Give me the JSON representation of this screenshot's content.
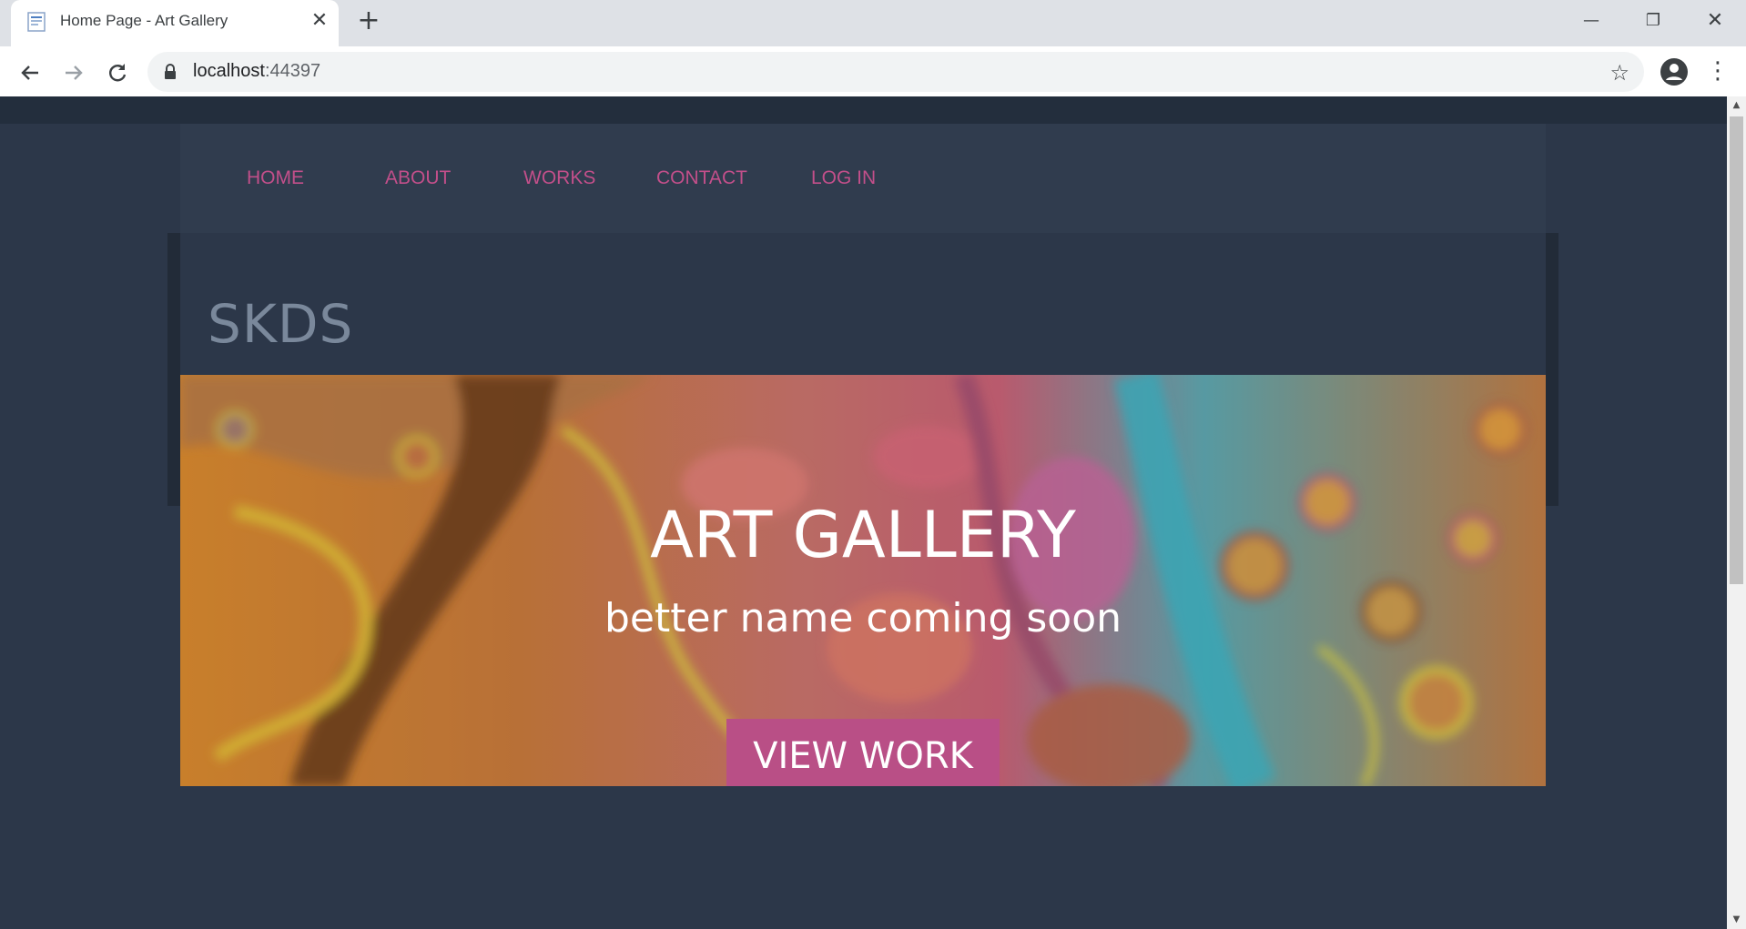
{
  "browser": {
    "tab_title": "Home Page - Art Gallery",
    "tab_close": "✕",
    "new_tab": "+",
    "url_host": "localhost",
    "url_port": ":44397",
    "win_minimize": "—",
    "win_maximize": "❐",
    "win_close": "✕"
  },
  "nav": {
    "links": [
      "HOME",
      "ABOUT",
      "WORKS",
      "CONTACT",
      "LOG IN"
    ]
  },
  "header": {
    "site_name": "SKDS"
  },
  "hero": {
    "title": "ART GALLERY",
    "subtitle": "better name coming soon",
    "button": "VIEW WORK"
  },
  "colors": {
    "page_bg": "#2c3749",
    "nav_bg": "#303c4e",
    "accent": "#c24f8a",
    "button_bg": "#b94f86"
  }
}
